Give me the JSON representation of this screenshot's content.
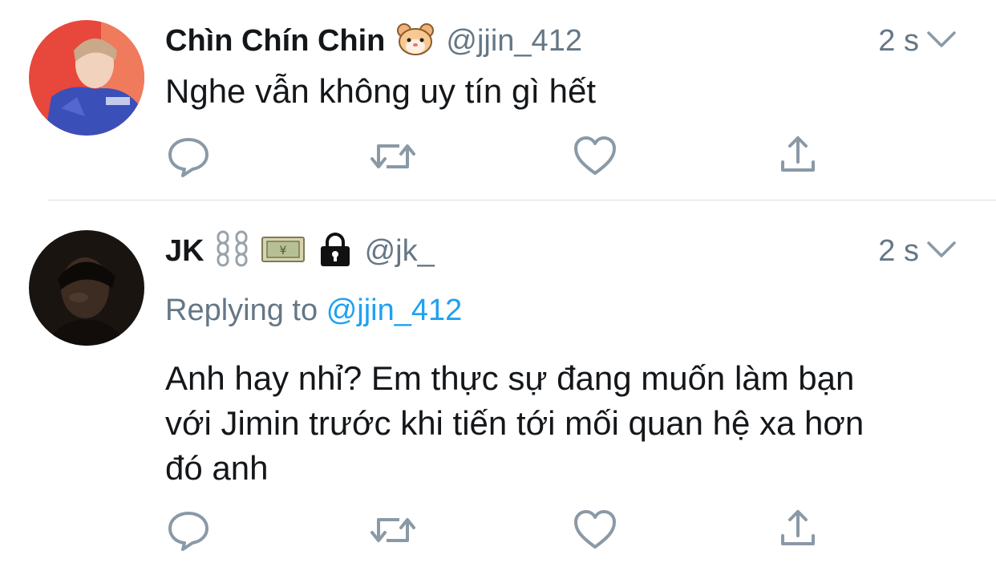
{
  "tweets": [
    {
      "display_name": "Chìn Chín Chin",
      "name_emojis": [
        "hamster-face-icon"
      ],
      "handle": "@jjin_412",
      "time": "2 s",
      "text": "Nghe vẫn không uy tín gì hết",
      "actions": [
        "reply-icon",
        "retweet-icon",
        "like-icon",
        "share-icon"
      ]
    },
    {
      "display_name": "JK",
      "name_emojis": [
        "chains-icon",
        "yen-banknote-icon",
        "lock-icon"
      ],
      "handle": "@jk_",
      "time": "2 s",
      "replying_prefix": "Replying to",
      "replying_handle": "@jjin_412",
      "text_lines": [
        "Anh hay nhỉ? Em thực sự đang muốn làm bạn",
        "với Jimin trước khi tiến tới mối quan hệ xa hơn",
        "đó anh"
      ],
      "actions": [
        "reply-icon",
        "retweet-icon",
        "like-icon",
        "share-icon"
      ]
    }
  ],
  "colors": {
    "text": "#14171a",
    "muted": "#657786",
    "link": "#1da1f2",
    "icon": "#8a99a6",
    "divider": "#d8dde2"
  }
}
